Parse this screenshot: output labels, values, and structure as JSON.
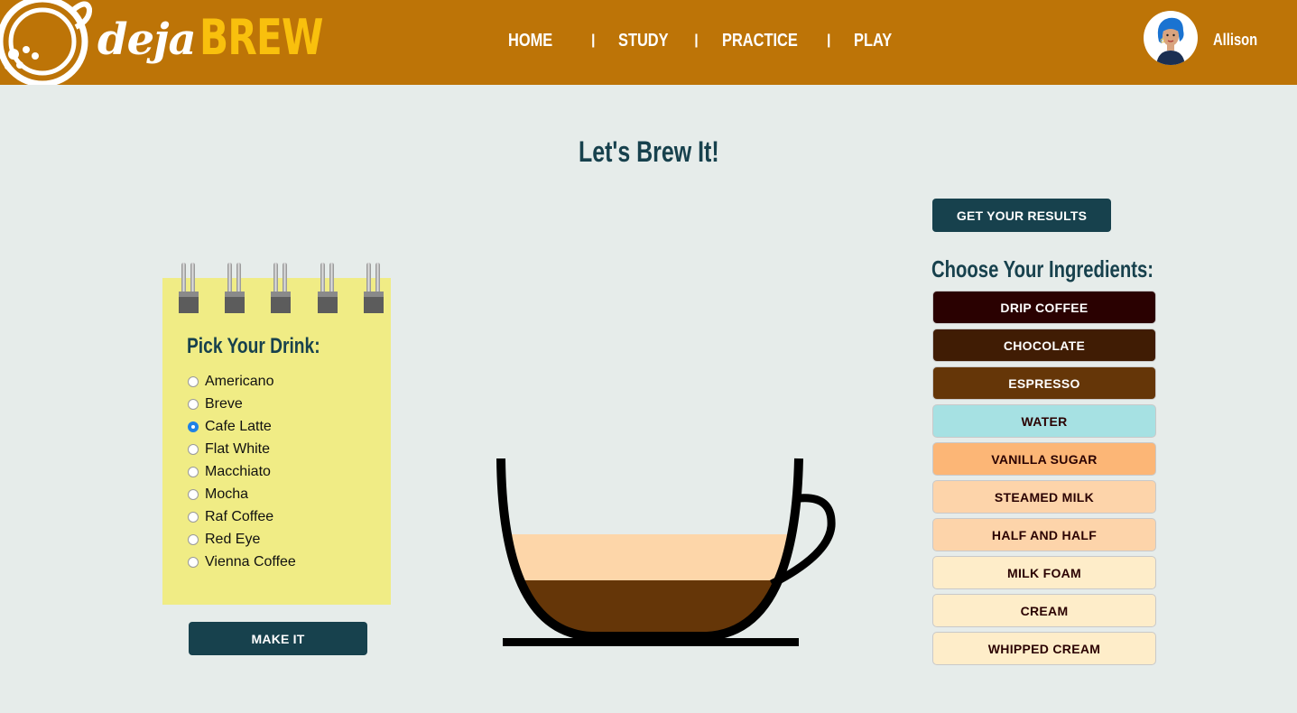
{
  "header": {
    "brand_deja": "deja",
    "brand_brew": "BREW",
    "nav": [
      "HOME",
      "STUDY",
      "PRACTICE",
      "PLAY"
    ],
    "separator": "|",
    "user_name": "Allison"
  },
  "main": {
    "title": "Let's Brew It!",
    "notepad_title": "Pick Your Drink:",
    "drinks": [
      "Americano",
      "Breve",
      "Cafe Latte",
      "Flat White",
      "Macchiato",
      "Mocha",
      "Raf Coffee",
      "Red Eye",
      "Vienna Coffee"
    ],
    "selected_drink": "Cafe Latte",
    "make_it_label": "MAKE IT",
    "results_label": "GET YOUR RESULTS",
    "ingredients_title": "Choose Your Ingredients:"
  },
  "ingredients": [
    {
      "label": "DRIP COFFEE",
      "bg": "#2a0101",
      "fg": "#ffffff"
    },
    {
      "label": "CHOCOLATE",
      "bg": "#401c04",
      "fg": "#ffffff"
    },
    {
      "label": "ESPRESSO",
      "bg": "#653608",
      "fg": "#ffffff"
    },
    {
      "label": "WATER",
      "bg": "#a6e1e3",
      "fg": "#2a0101"
    },
    {
      "label": "VANILLA SUGAR",
      "bg": "#fcb676",
      "fg": "#2a0101"
    },
    {
      "label": "STEAMED MILK",
      "bg": "#fdd4aa",
      "fg": "#2a0101"
    },
    {
      "label": "HALF AND HALF",
      "bg": "#fdd4aa",
      "fg": "#2a0101"
    },
    {
      "label": "MILK FOAM",
      "bg": "#feedc9",
      "fg": "#2a0101"
    },
    {
      "label": "CREAM",
      "bg": "#feedc9",
      "fg": "#2a0101"
    },
    {
      "label": "WHIPPED CREAM",
      "bg": "#feedc9",
      "fg": "#2a0101"
    }
  ],
  "cup_layers": [
    {
      "name": "espresso",
      "color": "#653608"
    },
    {
      "name": "steamed milk",
      "color": "#fdd6a9"
    }
  ],
  "colors": {
    "header_bg": "#bd7407",
    "brand_brew": "#f9c00d",
    "page_bg": "#e6ecea",
    "dark_teal": "#17414d",
    "notepad": "#f0ec85"
  },
  "icons": [
    "coffee-cup-logo-icon",
    "user-avatar-icon",
    "notepad-ring-icon"
  ]
}
